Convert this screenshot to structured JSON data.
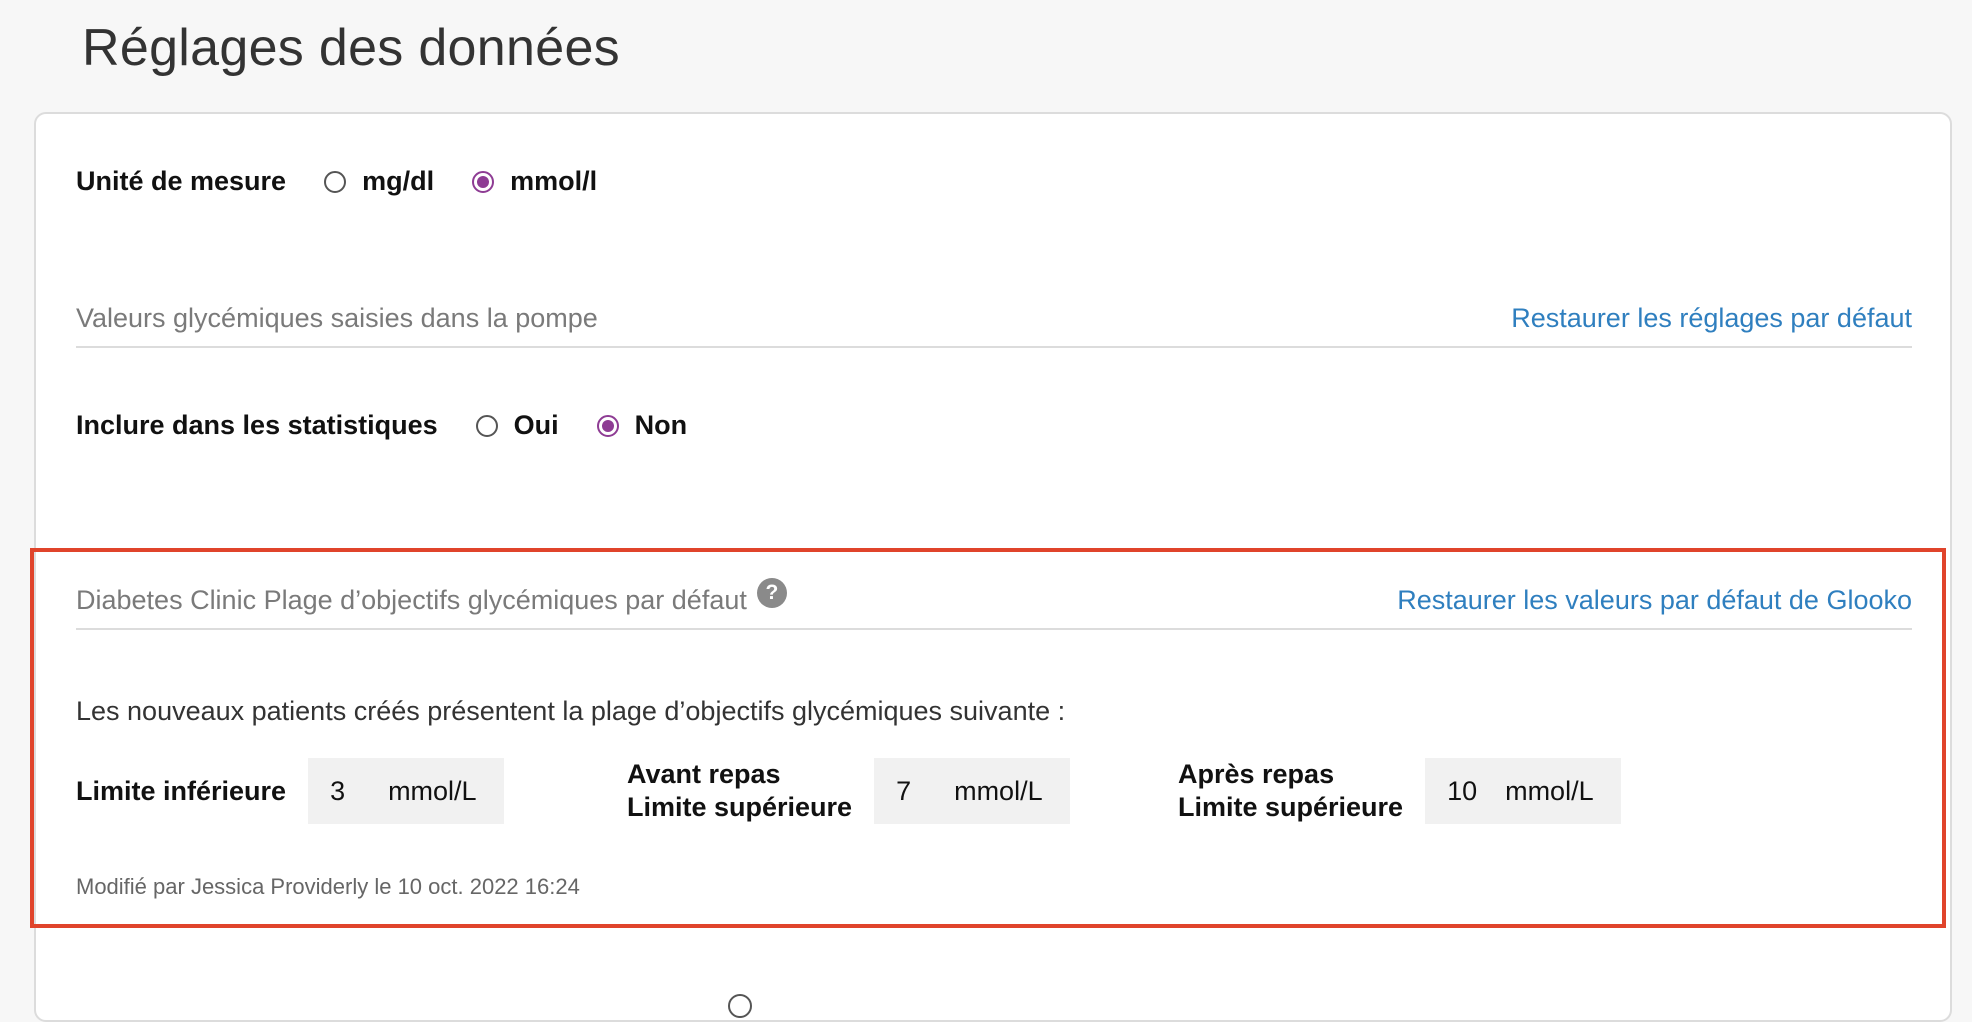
{
  "page": {
    "title": "Réglages des données"
  },
  "units": {
    "label": "Unité de mesure",
    "options": [
      "mg/dl",
      "mmol/l"
    ],
    "selected": "mmol/l"
  },
  "pump_section": {
    "title": "Valeurs glycémiques saisies dans la pompe",
    "restore_link": "Restaurer les réglages par défaut"
  },
  "stats": {
    "label": "Inclure dans les statistiques",
    "options": [
      "Oui",
      "Non"
    ],
    "selected": "Non"
  },
  "target_section": {
    "title": "Diabetes Clinic Plage d’objectifs glycémiques par défaut",
    "help_icon": "question-circle-icon",
    "restore_link": "Restaurer les valeurs par défaut de Glooko",
    "description": "Les nouveaux patients créés présentent la plage d’objectifs glycémiques suivante :",
    "lower": {
      "label": "Limite inférieure",
      "value": "3",
      "unit": "mmol/L"
    },
    "before_meal": {
      "label_line1": "Avant repas",
      "label_line2": "Limite supérieure",
      "value": "7",
      "unit": "mmol/L"
    },
    "after_meal": {
      "label_line1": "Après repas",
      "label_line2": "Limite supérieure",
      "value": "10",
      "unit": "mmol/L"
    },
    "modified_text": "Modifié par Jessica Providerly le 10 oct. 2022 16:24"
  },
  "colors": {
    "accent": "#8e3c94",
    "link": "#2f7fbf",
    "highlight_border": "#e0442b"
  }
}
